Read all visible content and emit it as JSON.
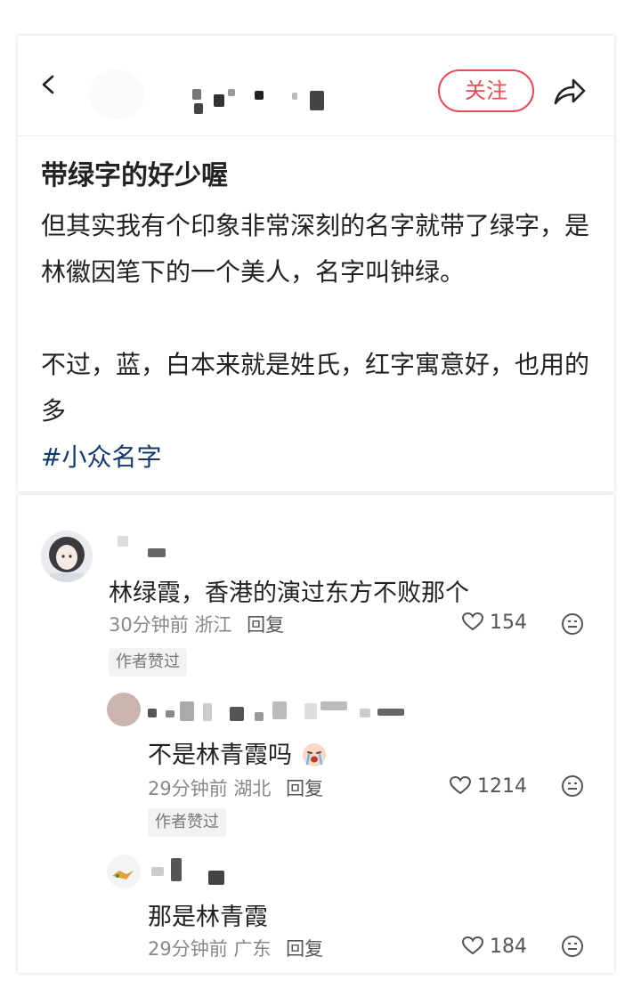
{
  "header": {
    "back_icon": "chevron-left-icon",
    "follow_label": "关注",
    "share_icon": "share-arrow-icon",
    "accent_color": "#e84a57"
  },
  "post": {
    "title": "带绿字的好少喔",
    "paragraph1": "但其实我有个印象非常深刻的名字就带了绿字，是林徽因笔下的一个美人，名字叫钟绿。",
    "paragraph2": "不过，蓝，白本来就是姓氏，红字寓意好，也用的多",
    "hashtag": "#小众名字",
    "hashtag_color": "#12386e"
  },
  "comments": [
    {
      "text": "林绿霞，香港的演过东方不败那个",
      "time": "30分钟前",
      "location": "浙江",
      "reply_label": "回复",
      "likes": "154",
      "badge": "作者赞过"
    },
    {
      "text": "不是林青霞吗",
      "emoji": "crying-baby-emoji",
      "time": "29分钟前",
      "location": "湖北",
      "reply_label": "回复",
      "likes": "1214",
      "badge": "作者赞过"
    },
    {
      "text": "那是林青霞",
      "time": "29分钟前",
      "location": "广东",
      "reply_label": "回复",
      "likes": "184"
    }
  ]
}
